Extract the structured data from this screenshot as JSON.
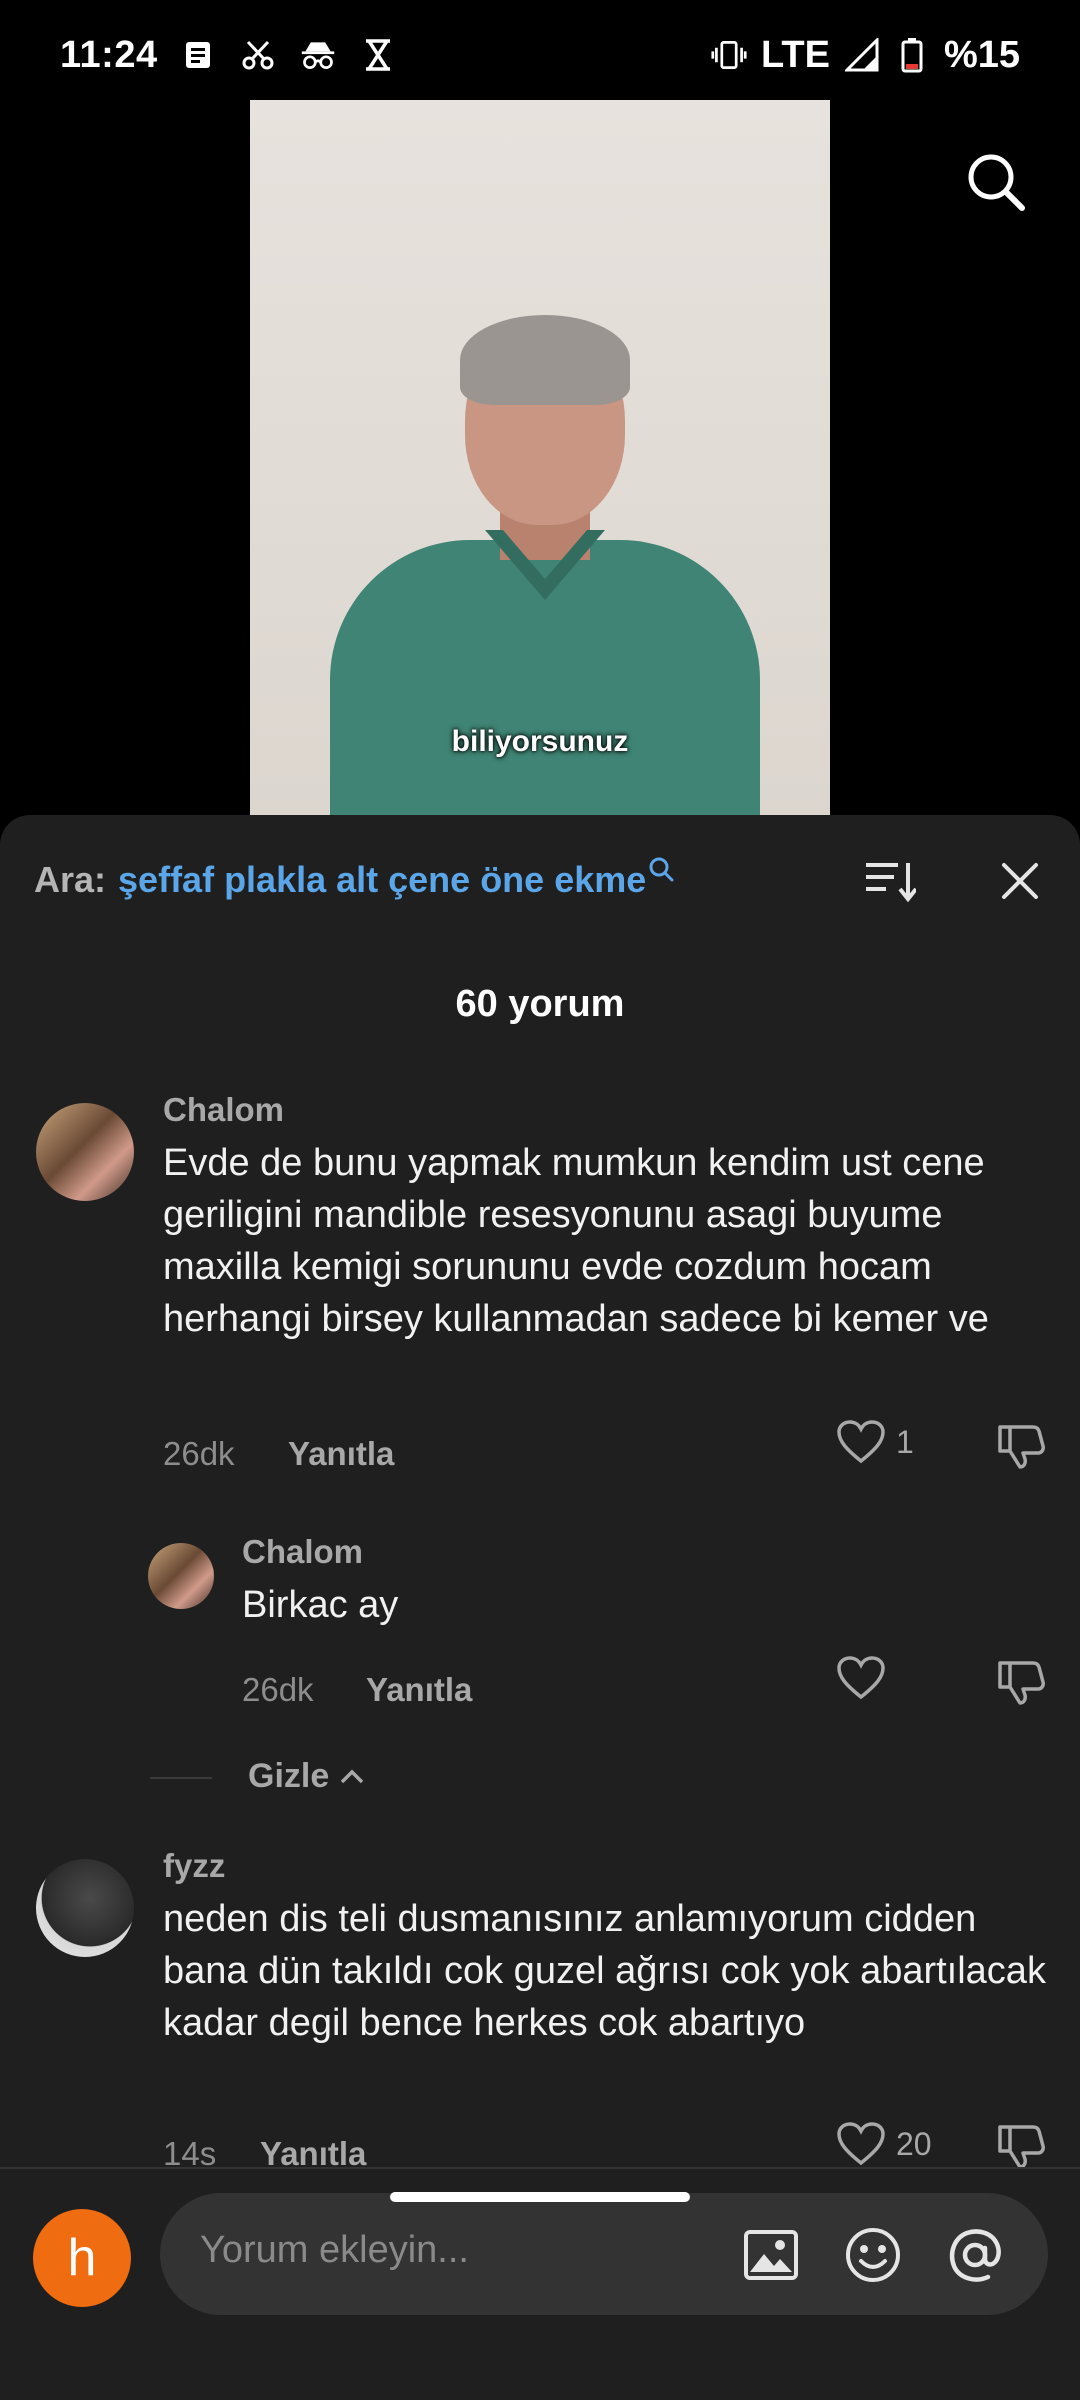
{
  "status_bar": {
    "time": "11:24",
    "network": "LTE",
    "battery": "%15",
    "left_icons": [
      "note-icon",
      "scissors-icon",
      "incognito-icon",
      "hourglass-icon"
    ],
    "right_icons": [
      "vibrate-icon",
      "signal-icon",
      "battery-icon"
    ]
  },
  "video": {
    "caption": "biliyorsunuz"
  },
  "search_header": {
    "label": "Ara:",
    "query": "şeffaf plakla alt çene öne ekme"
  },
  "comments_title": "60 yorum",
  "comments": [
    {
      "user": "Chalom",
      "text": "Evde de bunu yapmak mumkun kendim ust cene geriligini mandible resesyonunu asagi buyume maxilla kemigi sorununu evde cozdum hocam herhangi birsey kullanmadan sadece bi kemer ve",
      "time": "26dk",
      "reply_label": "Yanıtla",
      "likes": "1"
    },
    {
      "user": "Chalom",
      "text": "Birkac ay",
      "time": "26dk",
      "reply_label": "Yanıtla",
      "likes": ""
    },
    {
      "user": "fyzz",
      "text": "neden dis teli dusmanısınız anlamıyorum cidden bana dün takıldı cok guzel ağrısı cok yok abartılacak kadar degil bence herkes cok abartıyo",
      "time": "14s",
      "reply_label": "Yanıtla",
      "likes": "20"
    }
  ],
  "hide_label": "Gizle",
  "composer": {
    "avatar_letter": "h",
    "placeholder": "Yorum ekleyin..."
  },
  "colors": {
    "sheet_bg": "#1f1f1f",
    "accent_link": "#5aa6e8",
    "avatar_orange": "#ef6c10"
  }
}
